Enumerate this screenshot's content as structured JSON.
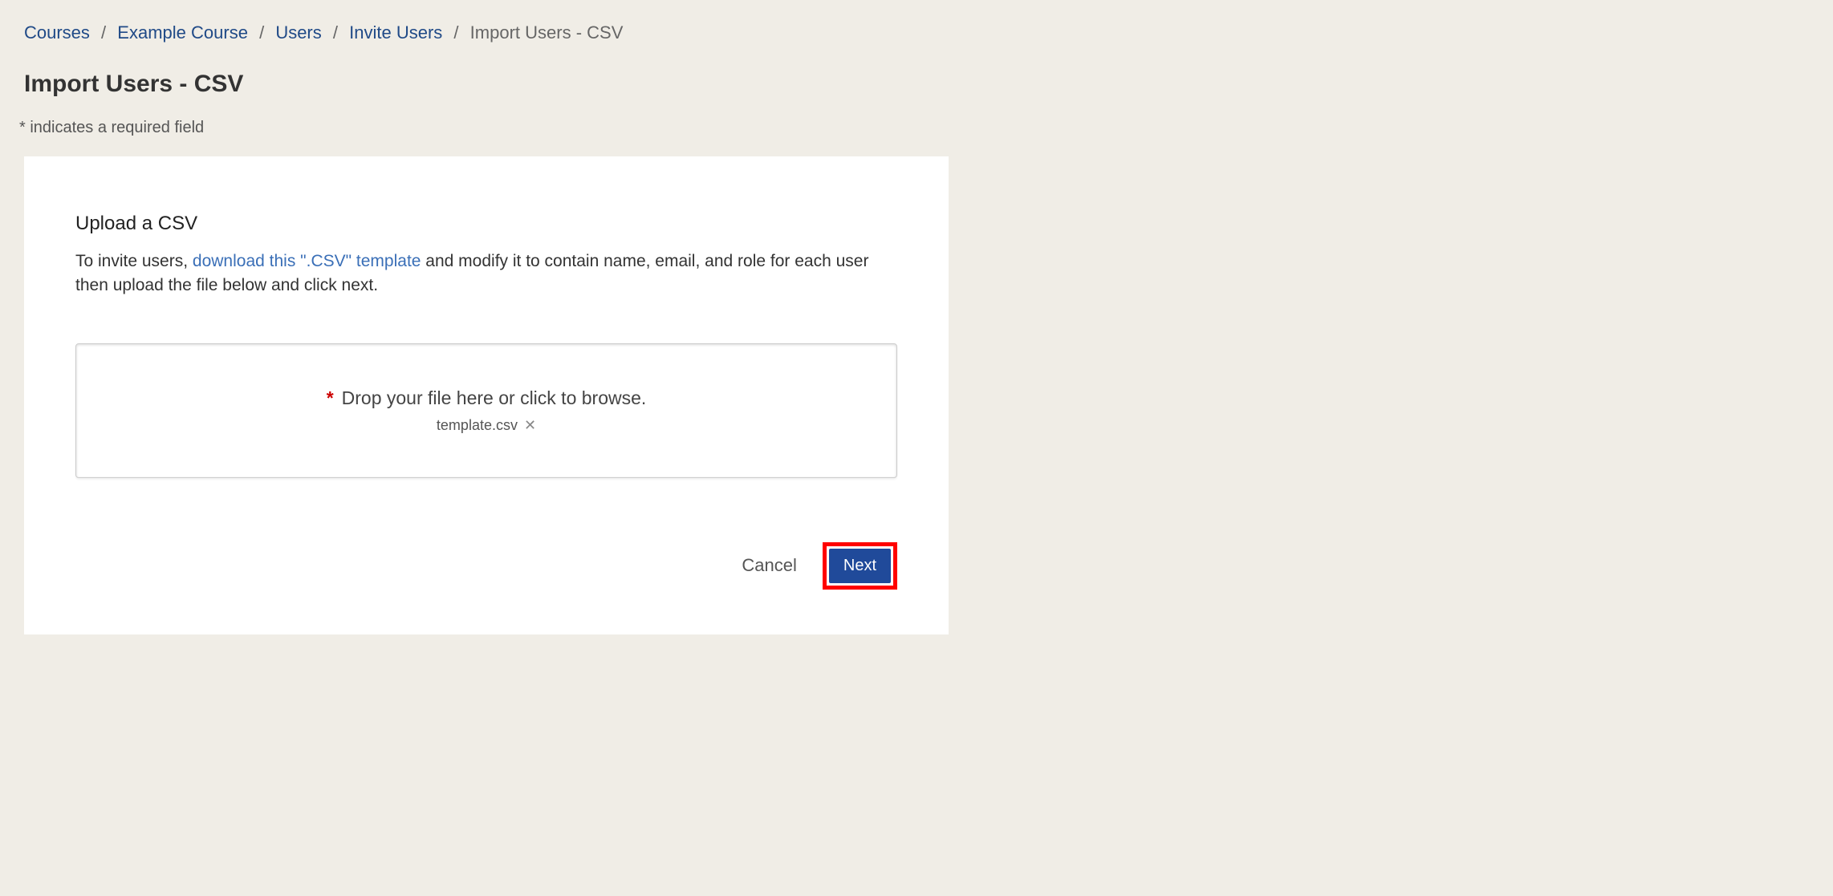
{
  "breadcrumb": {
    "items": [
      {
        "label": "Courses"
      },
      {
        "label": "Example Course"
      },
      {
        "label": "Users"
      },
      {
        "label": "Invite Users"
      }
    ],
    "current": "Import Users - CSV"
  },
  "page_title": "Import Users - CSV",
  "required_note": "* indicates a required field",
  "upload": {
    "section_title": "Upload a CSV",
    "instructions_before": "To invite users, ",
    "download_link_text": "download this \".CSV\" template",
    "instructions_after": " and modify it to contain name, email, and role for each user then upload the file below and click next.",
    "required_marker": "*",
    "drop_label": "Drop your file here or click to browse.",
    "file_name": "template.csv"
  },
  "actions": {
    "cancel_label": "Cancel",
    "next_label": "Next"
  }
}
